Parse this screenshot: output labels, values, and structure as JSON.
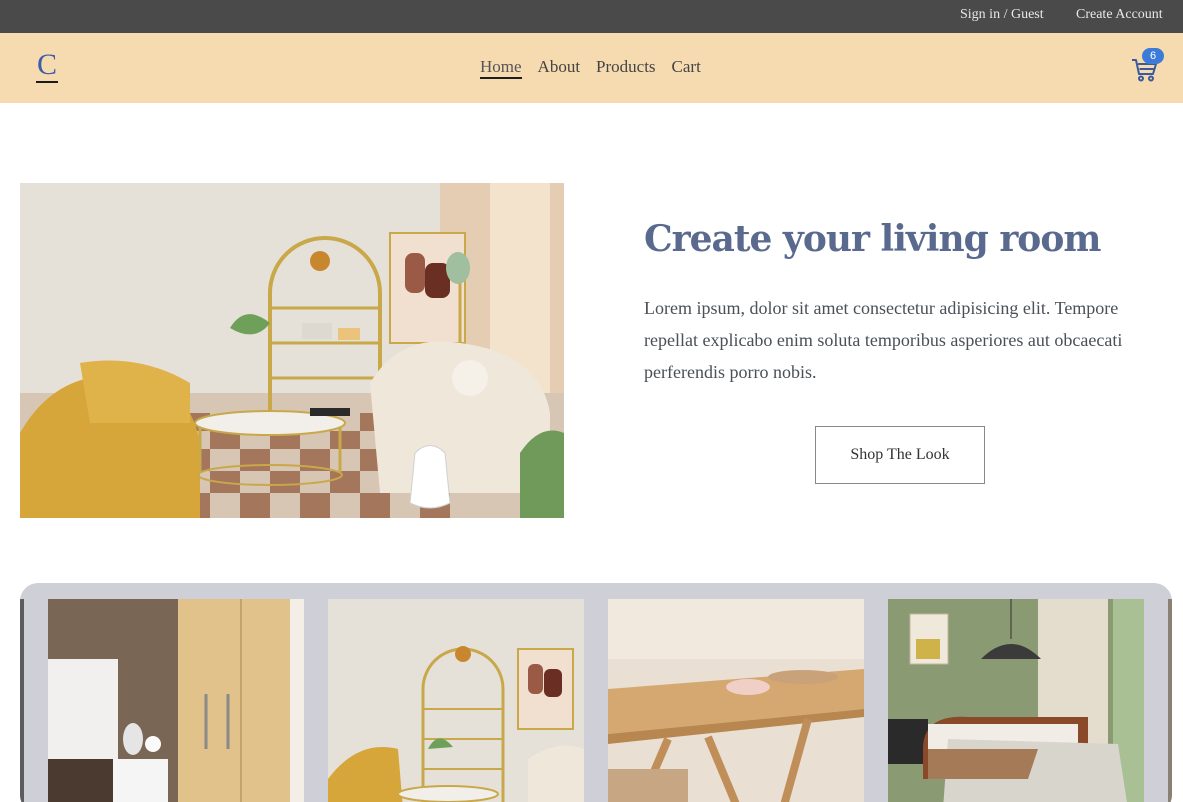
{
  "topbar": {
    "signin_label": "Sign in / Guest",
    "create_label": "Create Account"
  },
  "nav": {
    "logo": "C",
    "links": [
      {
        "label": "Home",
        "active": true
      },
      {
        "label": "About",
        "active": false
      },
      {
        "label": "Products",
        "active": false
      },
      {
        "label": "Cart",
        "active": false
      }
    ],
    "cart_icon": "shopping-cart-icon",
    "cart_count": "6"
  },
  "hero": {
    "image": "living-room-photo",
    "title": "Create your living room",
    "text": "Lorem ipsum, dolor sit amet consectetur adipisicing elit. Tempore repellat explicabo enim soluta temporibus asperiores aut obcaecati perferendis porro nobis.",
    "button_label": "Shop The Look"
  },
  "carousel": {
    "slides": [
      {
        "image": "bedroom-wardrobe-photo"
      },
      {
        "image": "living-room-photo"
      },
      {
        "image": "wooden-table-photo"
      },
      {
        "image": "green-bedroom-photo"
      }
    ]
  },
  "colors": {
    "topbar_bg": "#4a4a4a",
    "nav_bg": "#f7dbb0",
    "badge_bg": "#3d7bd9",
    "title_color": "#5a6a8e",
    "carousel_bg": "#cfcfd8"
  }
}
